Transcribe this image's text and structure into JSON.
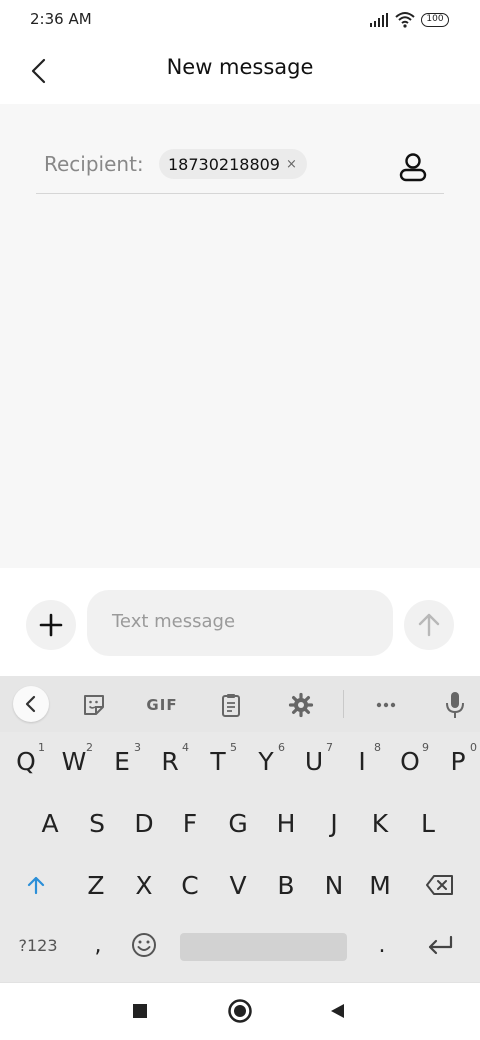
{
  "status_bar": {
    "time": "2:36 AM",
    "battery": "100"
  },
  "header": {
    "title": "New message"
  },
  "recipient": {
    "label": "Recipient:",
    "chip_value": "18730218809",
    "chip_remove": "×"
  },
  "compose": {
    "placeholder": "Text message"
  },
  "keyboard": {
    "toolbar": {
      "gif_label": "GIF"
    },
    "row1": [
      {
        "key": "Q",
        "num": "1"
      },
      {
        "key": "W",
        "num": "2"
      },
      {
        "key": "E",
        "num": "3"
      },
      {
        "key": "R",
        "num": "4"
      },
      {
        "key": "T",
        "num": "5"
      },
      {
        "key": "Y",
        "num": "6"
      },
      {
        "key": "U",
        "num": "7"
      },
      {
        "key": "I",
        "num": "8"
      },
      {
        "key": "O",
        "num": "9"
      },
      {
        "key": "P",
        "num": "0"
      }
    ],
    "row2": [
      "A",
      "S",
      "D",
      "F",
      "G",
      "H",
      "J",
      "K",
      "L"
    ],
    "row3": [
      "Z",
      "X",
      "C",
      "V",
      "B",
      "N",
      "M"
    ],
    "row4": {
      "symbols": "?123",
      "comma": ",",
      "period": "."
    },
    "accent_color": "#2b8fd8"
  }
}
